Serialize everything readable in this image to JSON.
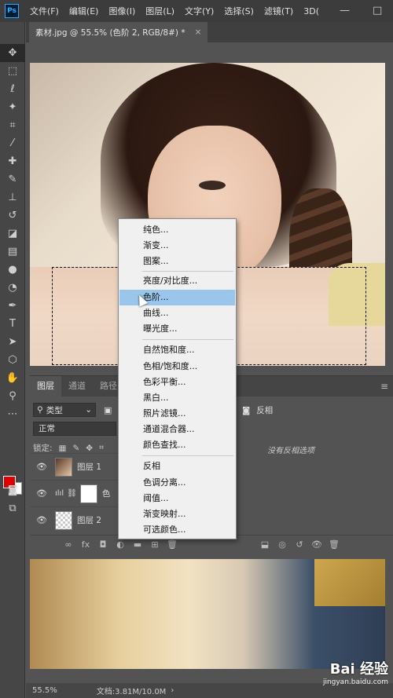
{
  "menubar": {
    "logo": "Ps",
    "items": [
      "文件(F)",
      "编辑(E)",
      "图像(I)",
      "图层(L)",
      "文字(Y)",
      "选择(S)",
      "滤镜(T)",
      "3D("
    ],
    "minimize": "—",
    "restore": "□"
  },
  "document": {
    "tab_title": "素材.jpg @ 55.5% (色阶 2, RGB/8#) *",
    "close": "×"
  },
  "layers_panel": {
    "tabs": [
      "图层",
      "通道",
      "路径"
    ],
    "filter_label": "类型",
    "blend_mode": "正常",
    "lock_label": "锁定:",
    "layers": [
      {
        "name": "图层 1"
      },
      {
        "name": "色"
      },
      {
        "name": "图层 2"
      }
    ]
  },
  "properties_panel": {
    "title": "反相",
    "hint": "没有反相选项"
  },
  "adjustment_menu": {
    "groups": [
      [
        "纯色...",
        "渐变...",
        "图案..."
      ],
      [
        "亮度/对比度...",
        "色阶...",
        "曲线...",
        "曝光度..."
      ],
      [
        "自然饱和度...",
        "色相/饱和度...",
        "色彩平衡...",
        "黑白...",
        "照片滤镜...",
        "通道混合器...",
        "颜色查找..."
      ],
      [
        "反相",
        "色调分离...",
        "阈值...",
        "渐变映射...",
        "可选颜色..."
      ]
    ],
    "highlighted": "色阶..."
  },
  "statusbar": {
    "zoom": "55.5%",
    "doc_info": "文档:3.81M/10.0M"
  },
  "watermark": {
    "logo": "Bai 经验",
    "url": "jingyan.baidu.com"
  },
  "colors": {
    "foreground": "#e00000",
    "background": "#ffffff",
    "menu_highlight": "#99c6ea"
  }
}
